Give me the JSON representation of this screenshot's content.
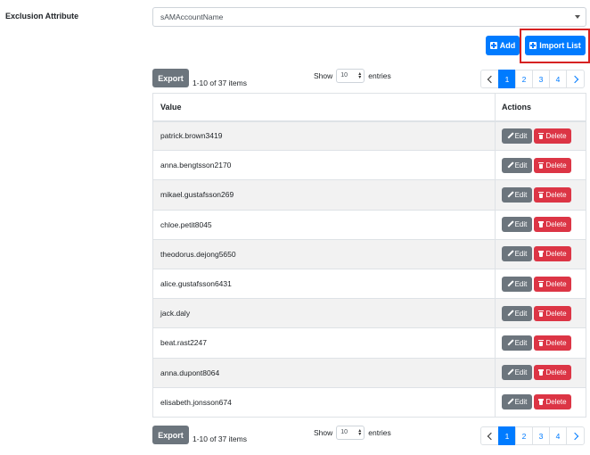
{
  "exclusion": {
    "label": "Exclusion Attribute",
    "selected": "sAMAccountName"
  },
  "toolbar": {
    "add_label": "Add",
    "import_label": "Import List"
  },
  "list_controls": {
    "export_label": "Export",
    "items_text": "1-10 of 37 items",
    "show_label": "Show",
    "page_size": "10",
    "entries_label": "entries"
  },
  "pagination": {
    "pages": [
      "1",
      "2",
      "3",
      "4"
    ],
    "current_page": 1
  },
  "table": {
    "headers": {
      "value": "Value",
      "actions": "Actions"
    },
    "edit_label": "Edit",
    "delete_label": "Delete",
    "rows": [
      "patrick.brown3419",
      "anna.bengtsson2170",
      "mikael.gustafsson269",
      "chloe.petit8045",
      "theodorus.dejong5650",
      "alice.gustafsson6431",
      "jack.daly",
      "beat.rast2247",
      "anna.dupont8064",
      "elisabeth.jonsson674"
    ]
  },
  "colors": {
    "primary": "#007bff",
    "secondary": "#6c757d",
    "danger": "#dc3545",
    "highlight": "#d62222"
  },
  "icons": {
    "add": "plus-square-icon",
    "import": "plus-square-icon",
    "edit": "pencil-icon",
    "delete": "trash-icon",
    "prev": "chevron-left-icon",
    "next": "chevron-right-icon",
    "select": "caret-down-icon"
  }
}
